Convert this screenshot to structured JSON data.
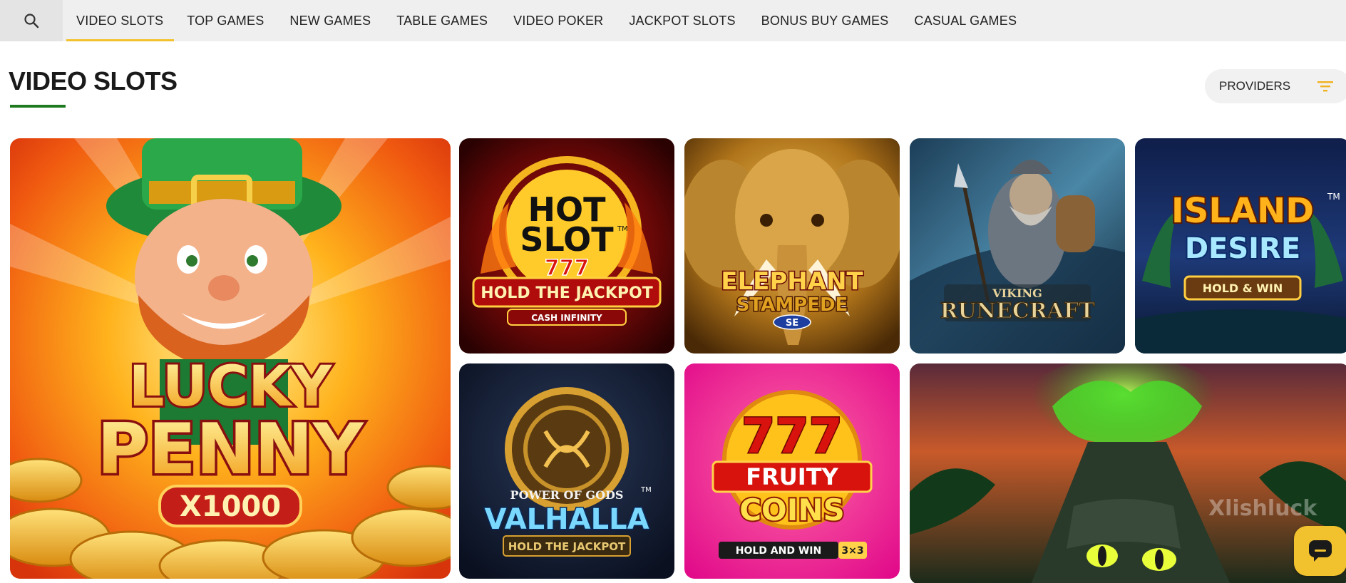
{
  "nav": {
    "tabs": [
      {
        "label": "VIDEO SLOTS",
        "active": true
      },
      {
        "label": "TOP GAMES"
      },
      {
        "label": "NEW GAMES"
      },
      {
        "label": "TABLE GAMES"
      },
      {
        "label": "VIDEO POKER"
      },
      {
        "label": "JACKPOT SLOTS"
      },
      {
        "label": "BONUS BUY GAMES"
      },
      {
        "label": "CASUAL GAMES"
      }
    ]
  },
  "page": {
    "title": "VIDEO SLOTS",
    "providers_label": "PROVIDERS"
  },
  "games": {
    "lucky_penny": {
      "title1": "LUCKY",
      "title2": "PENNY",
      "sub": "X1000"
    },
    "hot_slot": {
      "title1": "HOT",
      "title2": "SLOT",
      "num": "777",
      "sub": "HOLD THE JACKPOT",
      "tag": "CASH INFINITY",
      "tm": "TM"
    },
    "elephant": {
      "title1": "ELEPHANT",
      "title2": "STAMPEDE",
      "tag": "SE"
    },
    "viking": {
      "title1": "VIKING",
      "title2": "RUNECRAFT"
    },
    "island": {
      "title1": "ISLAND",
      "title2": "DESIRE",
      "sub": "HOLD & WIN",
      "tm": "TM"
    },
    "valhalla": {
      "pre": "POWER OF GODS",
      "title": "VALHALLA",
      "sub": "HOLD THE JACKPOT",
      "tm": "TM"
    },
    "fruity": {
      "num": "777",
      "title1": "FRUITY",
      "title2": "COINS",
      "sub": "HOLD AND WIN",
      "mult": "3×3"
    }
  },
  "watermark": "Xlishluck",
  "colors": {
    "accent": "#f2c22e",
    "underline": "#1f7a1f"
  },
  "icons": {
    "search": "search-icon",
    "filter": "filter-icon",
    "chat": "chat-icon"
  }
}
